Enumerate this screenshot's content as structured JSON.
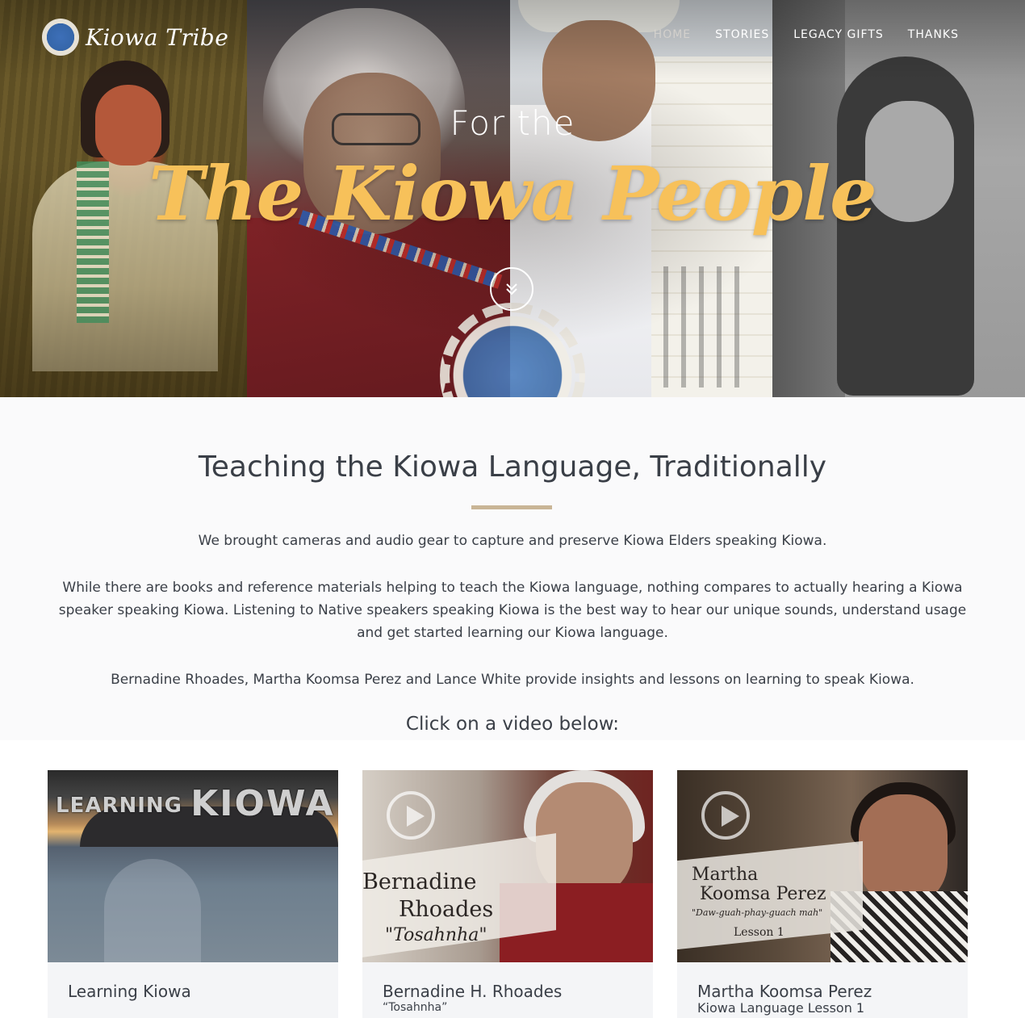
{
  "site": {
    "logo_text": "Kiowa Tribe"
  },
  "nav": {
    "items": [
      {
        "label": "HOME",
        "active": true
      },
      {
        "label": "STORIES",
        "active": false
      },
      {
        "label": "LEGACY GIFTS",
        "active": false
      },
      {
        "label": "THANKS",
        "active": false
      }
    ]
  },
  "hero": {
    "kicker": "For the",
    "title": "The Kiowa People",
    "scroll_icon": "double-chevron-down-icon"
  },
  "intro": {
    "heading": "Teaching the Kiowa Language, Traditionally",
    "para1": "We brought cameras and audio gear to capture and preserve Kiowa Elders speaking Kiowa.",
    "para2": "While there are books and reference materials helping to teach the Kiowa language, nothing compares to actually hearing a Kiowa speaker speaking Kiowa. Listening to Native speakers speaking Kiowa is the best way to hear our unique sounds, understand usage and get started learning our Kiowa language.",
    "para3": "Bernadine Rhoades, Martha Koomsa Perez and Lance White provide insights and lessons on learning to speak Kiowa.",
    "cta": "Click on a video below:"
  },
  "videos": [
    {
      "thumb_word1": "LEARNING",
      "thumb_word2": "KIOWA",
      "title": "Learning Kiowa",
      "subtitle": ""
    },
    {
      "thumb_name_line1": "Bernadine",
      "thumb_name_line2": "Rhoades",
      "thumb_nick": "\"Tosahnha\"",
      "title": "Bernadine H. Rhoades",
      "subtitle": "“Tosahnha”"
    },
    {
      "thumb_name_line1": "Martha",
      "thumb_name_line2": "Koomsa Perez",
      "thumb_quote": "\"Daw-guah-phay-guach mah\"",
      "thumb_lesson": "Lesson 1",
      "title": "Martha Koomsa Perez",
      "subtitle": "Kiowa Language Lesson 1"
    }
  ],
  "colors": {
    "accent_gold": "#f7c15a",
    "divider_tan": "#c9b596",
    "text_dark": "#3a3f47"
  }
}
